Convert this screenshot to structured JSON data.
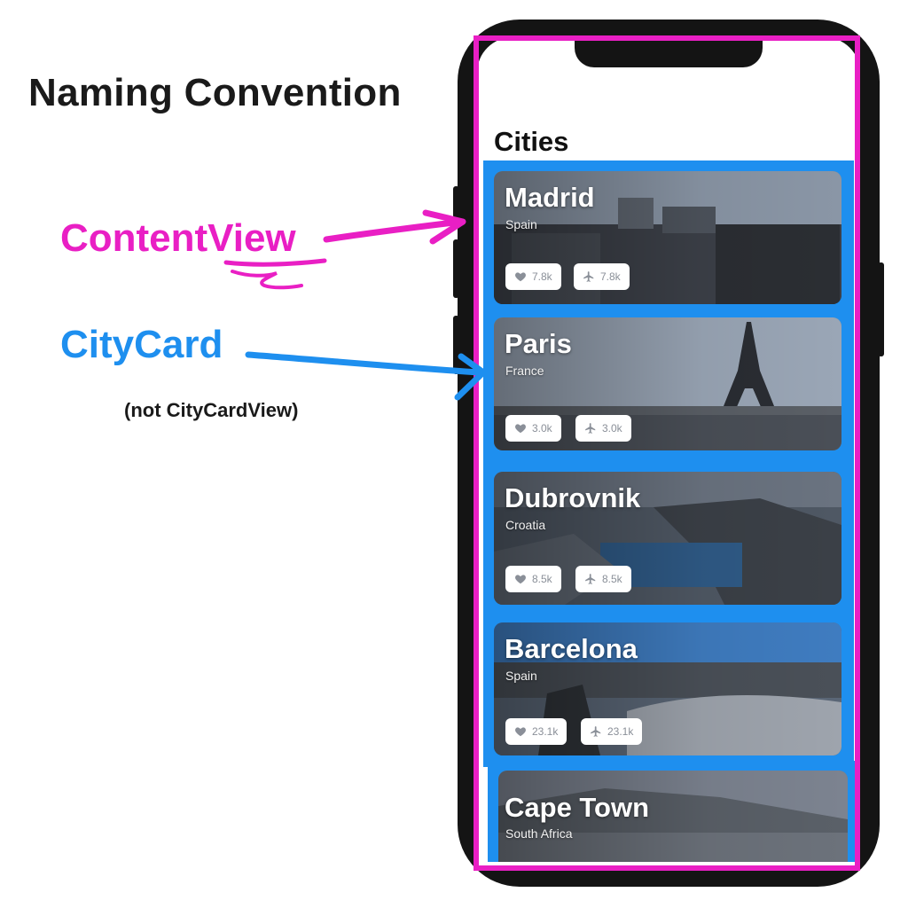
{
  "heading": "Naming Convention",
  "annotations": {
    "content_view": "ContentView",
    "city_card": "CityCard",
    "note": "(not CityCardView)",
    "colors": {
      "content_view": "#e91fc4",
      "city_card": "#1e8fef"
    }
  },
  "screen": {
    "title": "Cities",
    "cards": [
      {
        "name": "Madrid",
        "country": "Spain",
        "likes": "7.8k",
        "trips": "7.8k"
      },
      {
        "name": "Paris",
        "country": "France",
        "likes": "3.0k",
        "trips": "3.0k"
      },
      {
        "name": "Dubrovnik",
        "country": "Croatia",
        "likes": "8.5k",
        "trips": "8.5k"
      },
      {
        "name": "Barcelona",
        "country": "Spain",
        "likes": "23.1k",
        "trips": "23.1k"
      },
      {
        "name": "Cape Town",
        "country": "South Africa"
      }
    ]
  },
  "icons": {
    "like": "heart-icon",
    "trip": "airplane-icon"
  }
}
